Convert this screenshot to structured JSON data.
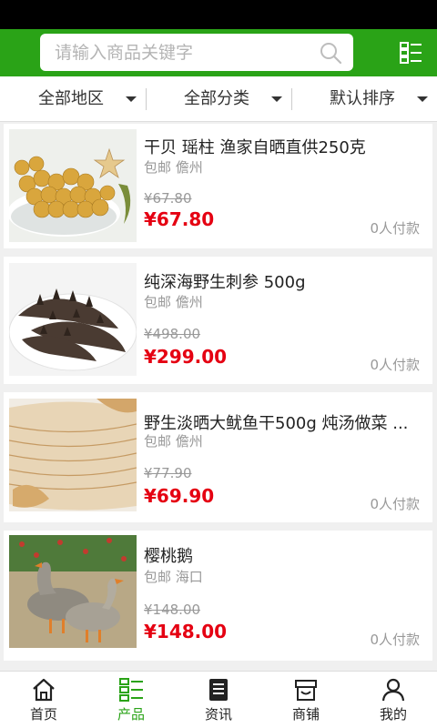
{
  "search": {
    "placeholder": "请输入商品关键字"
  },
  "filters": {
    "region": "全部地区",
    "category": "全部分类",
    "sort": "默认排序"
  },
  "products": [
    {
      "title": "干贝 瑶柱 渔家自晒直供250克",
      "shipping": "包邮",
      "location": "儋州",
      "old_price": "¥67.80",
      "price": "¥67.80",
      "sold": "0人付款"
    },
    {
      "title": "纯深海野生刺参 500g",
      "shipping": "包邮",
      "location": "儋州",
      "old_price": "¥498.00",
      "price": "¥299.00",
      "sold": "0人付款"
    },
    {
      "title": "野生淡晒大鱿鱼干500g 炖汤做菜 ...",
      "shipping": "包邮",
      "location": "儋州",
      "old_price": "¥77.90",
      "price": "¥69.90",
      "sold": "0人付款"
    },
    {
      "title": "樱桃鹅",
      "shipping": "包邮",
      "location": "海口",
      "old_price": "¥148.00",
      "price": "¥148.00",
      "sold": "0人付款"
    }
  ],
  "tabs": [
    {
      "label": "首页",
      "icon": "home-icon"
    },
    {
      "label": "产品",
      "icon": "product-list-icon"
    },
    {
      "label": "资讯",
      "icon": "news-icon"
    },
    {
      "label": "商铺",
      "icon": "store-icon"
    },
    {
      "label": "我的",
      "icon": "user-icon"
    }
  ],
  "colors": {
    "brand_green": "#2aa317",
    "price_red": "#e50012",
    "muted": "#999999"
  }
}
